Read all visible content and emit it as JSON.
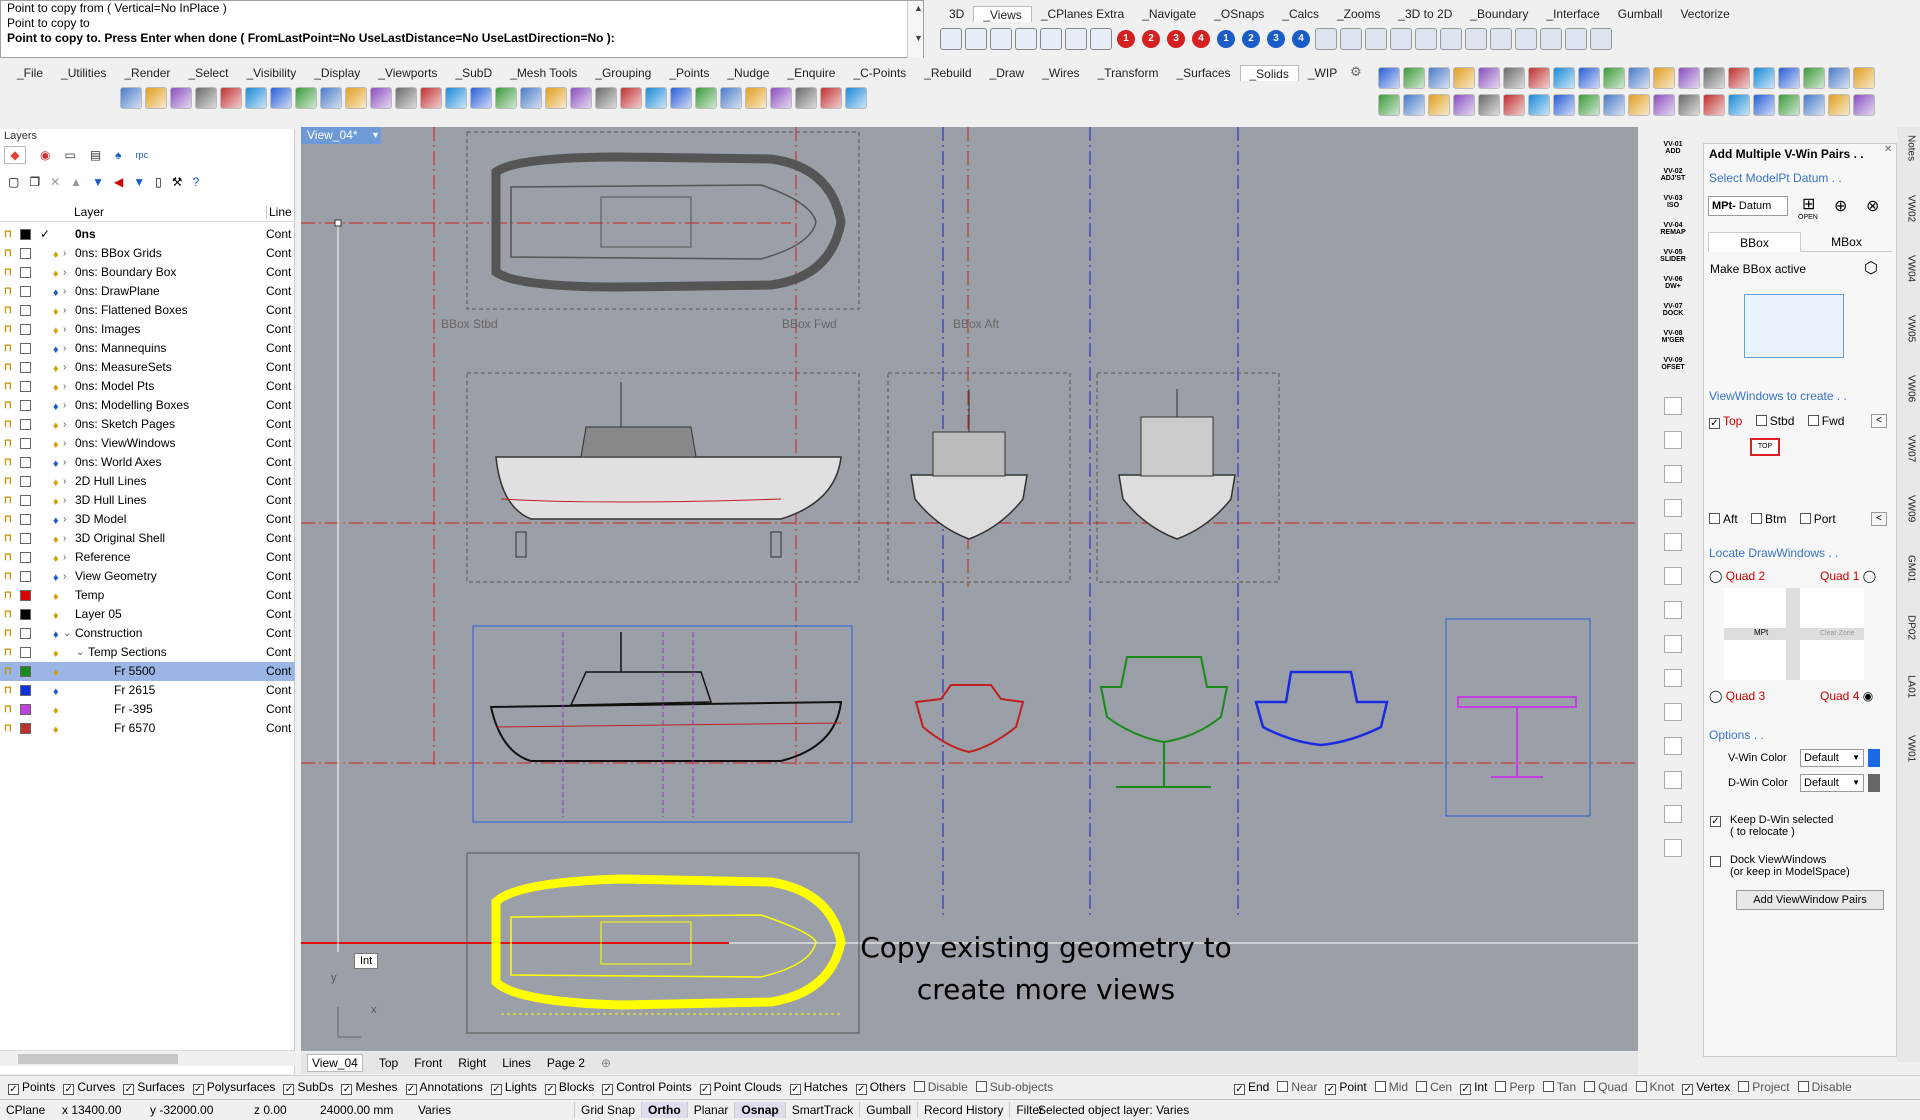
{
  "command": {
    "line1": "Point to copy from ( Vertical=No  InPlace )",
    "line2": "Point to copy to",
    "line3": "Point to copy to. Press Enter when done ( FromLastPoint=No  UseLastDistance=No  UseLastDirection=No ):"
  },
  "top_tabs": [
    "3D",
    "_Views",
    "_CPlanes Extra",
    "_Navigate",
    "_OSnaps",
    "_Calcs",
    "_Zooms",
    "_3D to 2D",
    "_Boundary",
    "_Interface",
    "Gumball",
    "Vectorize"
  ],
  "top_tab_active": "_Views",
  "menu_tabs": [
    "_File",
    "_Utilities",
    "_Render",
    "_Select",
    "_Visibility",
    "_Display",
    "_Viewports",
    "_SubD",
    "_Mesh Tools",
    "_Grouping",
    "_Points",
    "_Nudge",
    "_Enquire",
    "_C-Points",
    "_Rebuild",
    "_Draw",
    "_Wires",
    "_Transform",
    "_Surfaces",
    "_Solids",
    "_WIP"
  ],
  "menu_tab_active": "_Solids",
  "number_buttons": [
    "1",
    "2",
    "3",
    "4",
    "1",
    "2",
    "3",
    "4"
  ],
  "layers_panel": {
    "title": "Layers",
    "col_layer": "Layer",
    "col_line": "Line",
    "rows": [
      {
        "name": "0ns",
        "line": "Cont",
        "color": "#000000",
        "level": 0,
        "current": true,
        "bold": true
      },
      {
        "name": "0ns: BBox Grids",
        "line": "Cont",
        "color": "#ffffff",
        "level": 0,
        "expand": true
      },
      {
        "name": "0ns: Boundary Box",
        "line": "Cont",
        "color": "#ffffff",
        "level": 0,
        "expand": true
      },
      {
        "name": "0ns: DrawPlane",
        "line": "Cont",
        "color": "#ffffff",
        "level": 0,
        "expand": true
      },
      {
        "name": "0ns: Flattened Boxes",
        "line": "Cont",
        "color": "#ffffff",
        "level": 0,
        "expand": true
      },
      {
        "name": "0ns: Images",
        "line": "Cont",
        "color": "#ffffff",
        "level": 0,
        "expand": true
      },
      {
        "name": "0ns: Mannequins",
        "line": "Cont",
        "color": "#ffffff",
        "level": 0,
        "expand": true
      },
      {
        "name": "0ns: MeasureSets",
        "line": "Cont",
        "color": "#ffffff",
        "level": 0,
        "expand": true
      },
      {
        "name": "0ns: Model Pts",
        "line": "Cont",
        "color": "#ffffff",
        "level": 0,
        "expand": true
      },
      {
        "name": "0ns: Modelling Boxes",
        "line": "Cont",
        "color": "#ffffff",
        "level": 0,
        "expand": true
      },
      {
        "name": "0ns: Sketch Pages",
        "line": "Cont",
        "color": "#ffffff",
        "level": 0,
        "expand": true
      },
      {
        "name": "0ns: ViewWindows",
        "line": "Cont",
        "color": "#ffffff",
        "level": 0,
        "expand": true
      },
      {
        "name": "0ns: World Axes",
        "line": "Cont",
        "color": "#ffffff",
        "level": 0,
        "expand": true
      },
      {
        "name": "2D Hull Lines",
        "line": "Cont",
        "color": "#ffffff",
        "level": 0,
        "expand": true
      },
      {
        "name": "3D Hull Lines",
        "line": "Cont",
        "color": "#ffffff",
        "level": 0,
        "expand": true
      },
      {
        "name": "3D Model",
        "line": "Cont",
        "color": "#ffffff",
        "level": 0,
        "expand": true
      },
      {
        "name": "3D Original Shell",
        "line": "Cont",
        "color": "#ffffff",
        "level": 0,
        "expand": true
      },
      {
        "name": "Reference",
        "line": "Cont",
        "color": "#ffffff",
        "level": 0,
        "expand": true
      },
      {
        "name": "View Geometry",
        "line": "Cont",
        "color": "#ffffff",
        "level": 0,
        "expand": true
      },
      {
        "name": "Temp",
        "line": "Cont",
        "color": "#e00000",
        "level": 0
      },
      {
        "name": "Layer 05",
        "line": "Cont",
        "color": "#000000",
        "level": 0
      },
      {
        "name": "Construction",
        "line": "Cont",
        "color": "#ffffff",
        "level": 0,
        "expanded": true
      },
      {
        "name": "Temp Sections",
        "line": "Cont",
        "color": "#ffffff",
        "level": 1,
        "expanded": true
      },
      {
        "name": "Fr 5500",
        "line": "Cont",
        "color": "#1a8a1a",
        "level": 2,
        "selected": true
      },
      {
        "name": "Fr 2615",
        "line": "Cont",
        "color": "#1030e0",
        "level": 2
      },
      {
        "name": "Fr -395",
        "line": "Cont",
        "color": "#c040e0",
        "level": 2
      },
      {
        "name": "Fr 6570",
        "line": "Cont",
        "color": "#c03030",
        "level": 2
      }
    ]
  },
  "viewport": {
    "title": "View_04*",
    "bbox_labels": [
      "BBox Stbd",
      "BBox Fwd",
      "BBox Aft"
    ],
    "annotation_line1": "Copy existing geometry to",
    "annotation_line2": "create more views",
    "snap_tag": "Int",
    "axis_x": "x",
    "axis_y": "y"
  },
  "view_tabs": [
    "View_04",
    "Top",
    "Front",
    "Right",
    "Lines",
    "Page 2"
  ],
  "side_buttons": [
    {
      "a": "VV-01",
      "b": "ADD"
    },
    {
      "a": "VV-02",
      "b": "ADJ'ST"
    },
    {
      "a": "VV-03",
      "b": "ISO"
    },
    {
      "a": "VV-04",
      "b": "REMAP"
    },
    {
      "a": "VV-05",
      "b": "SLIDER"
    },
    {
      "a": "VV-06",
      "b": "DW+"
    },
    {
      "a": "VV-07",
      "b": "DOCK"
    },
    {
      "a": "VV-08",
      "b": "M'GER"
    },
    {
      "a": "VV-09",
      "b": "OFSET"
    }
  ],
  "panel": {
    "title": "Add Multiple V-Win Pairs . .",
    "select_datum": "Select ModelPt Datum . .",
    "mpt_label": "MPt-",
    "mpt_value": "Datum",
    "open_label": "OPEN",
    "tab_bbox": "BBox",
    "tab_mbox": "MBox",
    "make_active": "Make BBox active",
    "viewwindows_to_create": "ViewWindows to create . .",
    "cb_top": "Top",
    "cb_stbd": "Stbd",
    "cb_fwd": "Fwd",
    "cb_aft": "Aft",
    "cb_btm": "Btm",
    "cb_port": "Port",
    "top_badge": "TOP",
    "locate_drawwindows": "Locate DrawWindows . .",
    "quad2": "Quad 2",
    "quad1": "Quad 1",
    "quad3": "Quad 3",
    "quad4": "Quad 4",
    "mpt_diagram": "MPt",
    "clear_zone": "Clear Zone",
    "options": "Options . .",
    "vwin_color_label": "V-Win Color",
    "vwin_color_value": "Default",
    "dwin_color_label": "D-Win Color",
    "dwin_color_value": "Default",
    "keep_dwin": "Keep D-Win selected",
    "keep_dwin2": "( to relocate )",
    "dock_vw": "Dock ViewWindows",
    "dock_vw2": "(or keep in ModelSpace)",
    "add_button": "Add ViewWindow Pairs"
  },
  "far_right_tabs": [
    "Notes",
    "VW02",
    "VW04",
    "VW05",
    "VW06",
    "VW07",
    "VW09",
    "GM01",
    "DP02",
    "LA01",
    "VW01"
  ],
  "osnap_bar": {
    "left": [
      {
        "label": "Points",
        "checked": true
      },
      {
        "label": "Curves",
        "checked": true
      },
      {
        "label": "Surfaces",
        "checked": true
      },
      {
        "label": "Polysurfaces",
        "checked": true
      },
      {
        "label": "SubDs",
        "checked": true
      },
      {
        "label": "Meshes",
        "checked": true
      },
      {
        "label": "Annotations",
        "checked": true
      },
      {
        "label": "Lights",
        "checked": true
      },
      {
        "label": "Blocks",
        "checked": true
      },
      {
        "label": "Control Points",
        "checked": true
      },
      {
        "label": "Point Clouds",
        "checked": true
      },
      {
        "label": "Hatches",
        "checked": true
      },
      {
        "label": "Others",
        "checked": true
      },
      {
        "label": "Disable",
        "checked": false
      },
      {
        "label": "Sub-objects",
        "checked": false
      }
    ],
    "right": [
      {
        "label": "End",
        "checked": true
      },
      {
        "label": "Near",
        "checked": false
      },
      {
        "label": "Point",
        "checked": true
      },
      {
        "label": "Mid",
        "checked": false
      },
      {
        "label": "Cen",
        "checked": false
      },
      {
        "label": "Int",
        "checked": true
      },
      {
        "label": "Perp",
        "checked": false
      },
      {
        "label": "Tan",
        "checked": false
      },
      {
        "label": "Quad",
        "checked": false
      },
      {
        "label": "Knot",
        "checked": false
      },
      {
        "label": "Vertex",
        "checked": true
      },
      {
        "label": "Project",
        "checked": false
      },
      {
        "label": "Disable",
        "checked": false
      }
    ]
  },
  "status": {
    "cplane": "CPlane",
    "x": "x 13400.00",
    "y": "y -32000.00",
    "z": "z 0.00",
    "units": "24000.00 mm",
    "layer_state": "Varies",
    "toggles": [
      "Grid Snap",
      "Ortho",
      "Planar",
      "Osnap",
      "SmartTrack",
      "Gumball",
      "Record History",
      "Filter"
    ],
    "bold_toggles": [
      "Ortho",
      "Osnap"
    ],
    "message": "Selected object layer: Varies"
  }
}
